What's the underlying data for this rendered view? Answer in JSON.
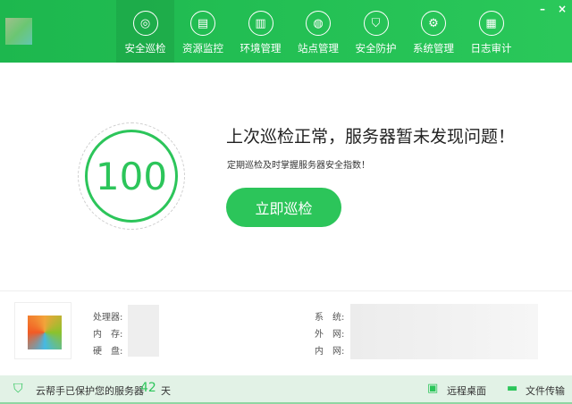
{
  "header": {
    "tabs": [
      {
        "label": "安全巡检",
        "icon": "radar-icon",
        "active": true
      },
      {
        "label": "资源监控",
        "icon": "monitor-chart-icon"
      },
      {
        "label": "环境管理",
        "icon": "building-icon"
      },
      {
        "label": "站点管理",
        "icon": "globe-icon"
      },
      {
        "label": "安全防护",
        "icon": "shield-icon"
      },
      {
        "label": "系统管理",
        "icon": "settings-monitor-icon"
      },
      {
        "label": "日志审计",
        "icon": "document-icon"
      }
    ],
    "minimize": "–",
    "close": "×"
  },
  "main": {
    "score": "100",
    "title": "上次巡检正常，服务器暂未发现问题！",
    "subtitle": "定期巡检及时掌握服务器安全指数！",
    "scan_button": "立即巡检"
  },
  "info": {
    "cpu": "处理器:",
    "memory": "内　存:",
    "disk": "硬　盘:",
    "system": "系　统:",
    "public_ip": "外　网:",
    "private_ip": "内　网:"
  },
  "footer": {
    "protect_text": "云帮手已保护您的服务器",
    "days": "42",
    "days_unit": "天",
    "remote_desktop": "远程桌面",
    "file_transfer": "文件传输"
  },
  "colors": {
    "accent": "#2cc55a"
  }
}
